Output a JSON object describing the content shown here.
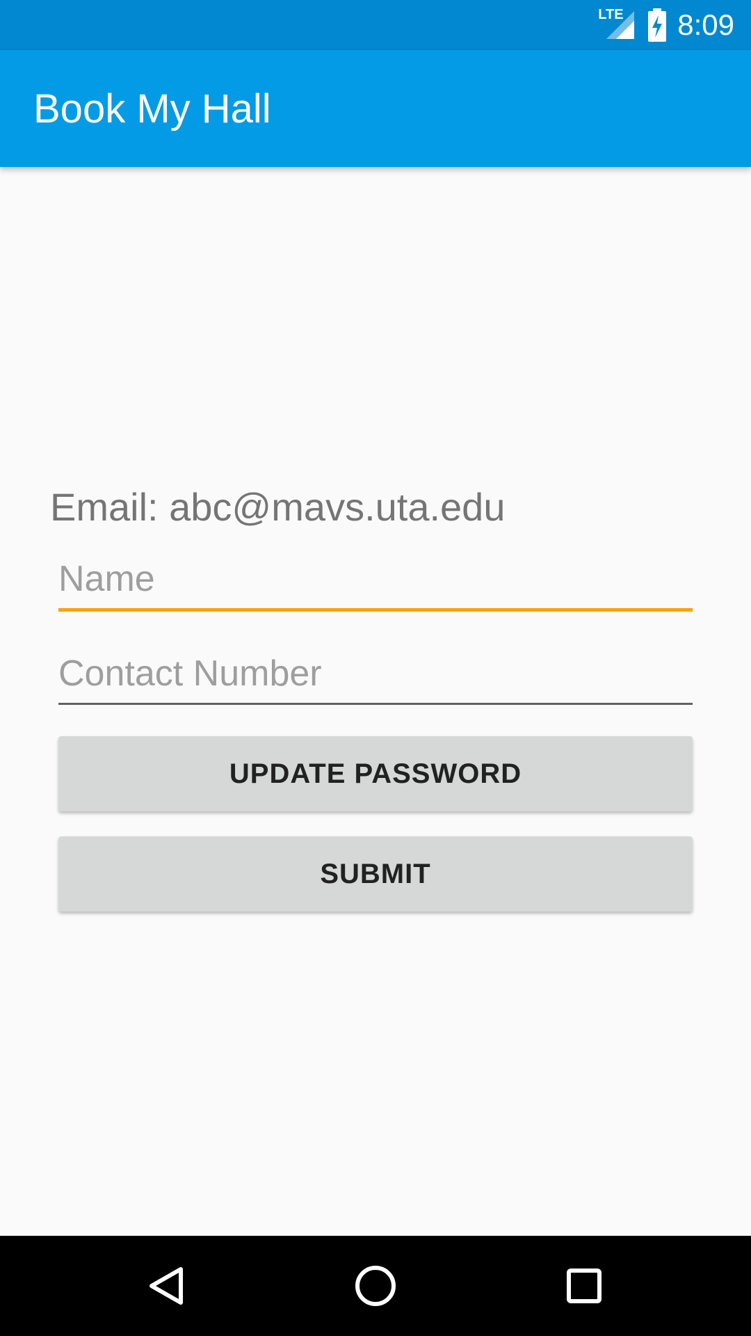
{
  "status_bar": {
    "network_label": "LTE",
    "time": "8:09",
    "icons": [
      "lte-signal-icon",
      "battery-charging-icon"
    ]
  },
  "app_bar": {
    "title": "Book My Hall"
  },
  "form": {
    "email_text": "Email: abc@mavs.uta.edu",
    "name_placeholder": "Name",
    "name_value": "",
    "contact_placeholder": "Contact Number",
    "contact_value": "",
    "update_password_label": "UPDATE PASSWORD",
    "submit_label": "SUBMIT"
  },
  "nav_bar": {
    "icons": [
      "back-icon",
      "home-icon",
      "recents-icon"
    ]
  },
  "colors": {
    "status_bar": "#0288d1",
    "app_bar": "#039be5",
    "focused_underline": "#ffa000",
    "button_bg": "#d6d7d7",
    "background": "#fafafa"
  }
}
